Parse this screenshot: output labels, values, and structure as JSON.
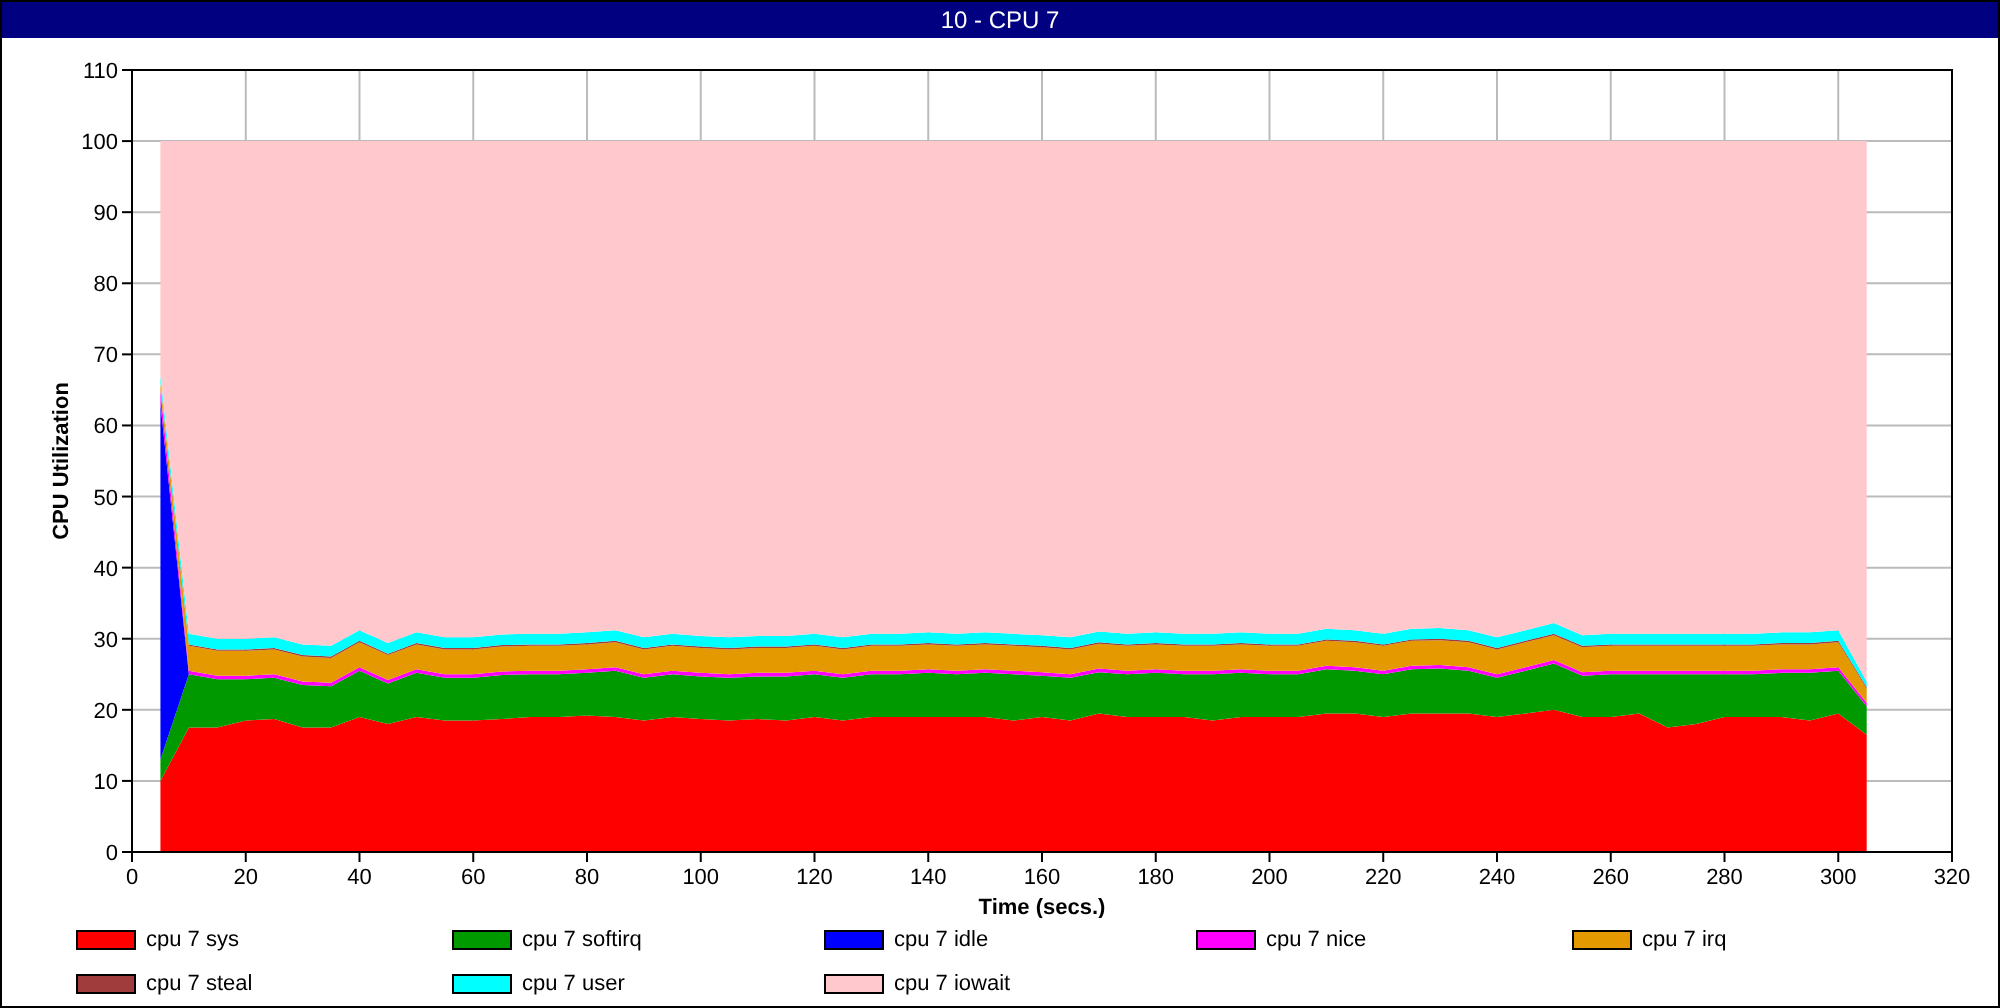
{
  "window": {
    "title": "10 - CPU 7"
  },
  "chart_data": {
    "type": "area",
    "stacked": true,
    "grid": true,
    "xlabel": "Time (secs.)",
    "ylabel": "CPU Utilization",
    "xlim": [
      0,
      320
    ],
    "ylim": [
      0,
      110
    ],
    "xticks": [
      0,
      20,
      40,
      60,
      80,
      100,
      120,
      140,
      160,
      180,
      200,
      220,
      240,
      260,
      280,
      300,
      320
    ],
    "yticks": [
      0,
      10,
      20,
      30,
      40,
      50,
      60,
      70,
      80,
      90,
      100,
      110
    ],
    "x": [
      5,
      10,
      15,
      20,
      25,
      30,
      35,
      40,
      45,
      50,
      55,
      60,
      65,
      70,
      75,
      80,
      85,
      90,
      95,
      100,
      105,
      110,
      115,
      120,
      125,
      130,
      135,
      140,
      145,
      150,
      155,
      160,
      165,
      170,
      175,
      180,
      185,
      190,
      195,
      200,
      205,
      210,
      215,
      220,
      225,
      230,
      235,
      240,
      245,
      250,
      255,
      260,
      265,
      270,
      275,
      280,
      285,
      290,
      295,
      300,
      305
    ],
    "series": [
      {
        "name": "cpu 7 sys",
        "color": "#ff0000",
        "values": [
          10,
          17.5,
          17.5,
          18.5,
          18.7,
          17.5,
          17.5,
          19,
          18,
          19,
          18.5,
          18.5,
          18.7,
          19,
          19,
          19.2,
          19,
          18.5,
          19,
          18.7,
          18.5,
          18.7,
          18.5,
          19,
          18.5,
          19,
          19,
          19,
          19,
          19,
          18.5,
          19,
          18.5,
          19.5,
          19,
          19,
          19,
          18.5,
          19,
          19,
          19,
          19.5,
          19.5,
          19,
          19.5,
          19.5,
          19.5,
          19,
          19.5,
          20,
          19,
          19,
          19.5,
          17.5,
          18,
          19,
          19,
          19,
          18.5,
          19.5,
          16.5
        ]
      },
      {
        "name": "cpu 7 softirq",
        "color": "#009900",
        "values": [
          3,
          7.5,
          6.8,
          5.8,
          5.8,
          6,
          5.8,
          6.5,
          5.7,
          6.2,
          6,
          6,
          6.2,
          6,
          6,
          6,
          6.5,
          6,
          6,
          6,
          6,
          6,
          6.2,
          6,
          6,
          6,
          6,
          6.2,
          6,
          6.2,
          6.5,
          5.8,
          6,
          5.8,
          6,
          6.2,
          6,
          6.5,
          6.2,
          6,
          6,
          6.2,
          6,
          6,
          6.2,
          6.3,
          6,
          5.5,
          6,
          6.5,
          5.8,
          6,
          5.5,
          7.5,
          7,
          6,
          6,
          6.2,
          6.7,
          6,
          4
        ]
      },
      {
        "name": "cpu 7 idle",
        "color": "#0000ff",
        "values": [
          50,
          0,
          0,
          0,
          0,
          0,
          0,
          0,
          0,
          0,
          0,
          0,
          0,
          0,
          0,
          0,
          0,
          0,
          0,
          0,
          0,
          0,
          0,
          0,
          0,
          0,
          0,
          0,
          0,
          0,
          0,
          0,
          0,
          0,
          0,
          0,
          0,
          0,
          0,
          0,
          0,
          0,
          0,
          0,
          0,
          0,
          0,
          0,
          0,
          0,
          0,
          0,
          0,
          0,
          0,
          0,
          0,
          0,
          0,
          0,
          0
        ]
      },
      {
        "name": "cpu 7 nice",
        "color": "#ff00ff",
        "values": [
          2,
          0.5,
          0.5,
          0.5,
          0.5,
          0.5,
          0.5,
          0.5,
          0.5,
          0.5,
          0.5,
          0.5,
          0.5,
          0.5,
          0.5,
          0.5,
          0.5,
          0.5,
          0.5,
          0.5,
          0.5,
          0.5,
          0.5,
          0.5,
          0.5,
          0.5,
          0.5,
          0.5,
          0.5,
          0.5,
          0.5,
          0.5,
          0.5,
          0.5,
          0.5,
          0.5,
          0.5,
          0.5,
          0.5,
          0.5,
          0.5,
          0.5,
          0.5,
          0.5,
          0.5,
          0.5,
          0.5,
          0.5,
          0.5,
          0.5,
          0.5,
          0.5,
          0.5,
          0.5,
          0.5,
          0.5,
          0.5,
          0.5,
          0.5,
          0.5,
          0.5
        ]
      },
      {
        "name": "cpu 7 irq",
        "color": "#e59900",
        "values": [
          1,
          3.5,
          3.5,
          3.5,
          3.5,
          3.5,
          3.5,
          3.5,
          3.5,
          3.5,
          3.5,
          3.5,
          3.5,
          3.5,
          3.5,
          3.5,
          3.5,
          3.5,
          3.5,
          3.5,
          3.5,
          3.5,
          3.5,
          3.5,
          3.5,
          3.5,
          3.5,
          3.5,
          3.5,
          3.5,
          3.5,
          3.5,
          3.5,
          3.5,
          3.5,
          3.5,
          3.5,
          3.5,
          3.5,
          3.5,
          3.5,
          3.5,
          3.5,
          3.5,
          3.5,
          3.5,
          3.5,
          3.5,
          3.5,
          3.5,
          3.5,
          3.5,
          3.5,
          3.5,
          3.5,
          3.5,
          3.5,
          3.5,
          3.5,
          3.5,
          2
        ]
      },
      {
        "name": "cpu 7 steal",
        "color": "#a03c3c",
        "values": [
          0,
          0.2,
          0.2,
          0.2,
          0.2,
          0.2,
          0.2,
          0.2,
          0.2,
          0.2,
          0.2,
          0.2,
          0.2,
          0.2,
          0.2,
          0.2,
          0.2,
          0.2,
          0.2,
          0.2,
          0.2,
          0.2,
          0.2,
          0.2,
          0.2,
          0.2,
          0.2,
          0.2,
          0.2,
          0.2,
          0.2,
          0.2,
          0.2,
          0.2,
          0.2,
          0.2,
          0.2,
          0.2,
          0.2,
          0.2,
          0.2,
          0.2,
          0.2,
          0.2,
          0.2,
          0.2,
          0.2,
          0.2,
          0.2,
          0.2,
          0.2,
          0.2,
          0.2,
          0.2,
          0.2,
          0.2,
          0.2,
          0.2,
          0.2,
          0.2,
          0.2
        ]
      },
      {
        "name": "cpu 7 user",
        "color": "#00ffff",
        "values": [
          1,
          1.5,
          1.5,
          1.5,
          1.5,
          1.5,
          1.5,
          1.5,
          1.5,
          1.5,
          1.5,
          1.5,
          1.5,
          1.5,
          1.5,
          1.5,
          1.5,
          1.5,
          1.5,
          1.5,
          1.5,
          1.5,
          1.5,
          1.5,
          1.5,
          1.5,
          1.5,
          1.5,
          1.5,
          1.5,
          1.5,
          1.5,
          1.5,
          1.5,
          1.5,
          1.5,
          1.5,
          1.5,
          1.5,
          1.5,
          1.5,
          1.5,
          1.5,
          1.5,
          1.5,
          1.5,
          1.5,
          1.5,
          1.5,
          1.5,
          1.5,
          1.5,
          1.5,
          1.5,
          1.5,
          1.5,
          1.5,
          1.5,
          1.5,
          1.5,
          0.8
        ]
      },
      {
        "name": "cpu 7 iowait",
        "color": "#ffc8cc",
        "values": [
          33,
          69.3,
          70,
          70,
          69.8,
          70.8,
          71,
          68.8,
          70.6,
          69.1,
          69.8,
          69.8,
          69.4,
          69.3,
          69.3,
          69.1,
          68.8,
          69.8,
          69.3,
          69.6,
          69.8,
          69.6,
          69.6,
          69.3,
          69.8,
          69.3,
          69.3,
          69.1,
          69.3,
          69.1,
          69.3,
          69.5,
          69.8,
          69,
          69.3,
          69.1,
          69.3,
          69.3,
          69.1,
          69.3,
          69.3,
          68.6,
          68.8,
          69.3,
          68.6,
          68.5,
          68.8,
          69.8,
          68.8,
          67.8,
          69.5,
          69.3,
          69.3,
          69.3,
          69.3,
          69.3,
          69.3,
          69.1,
          69.1,
          68.8,
          76
        ]
      }
    ]
  }
}
